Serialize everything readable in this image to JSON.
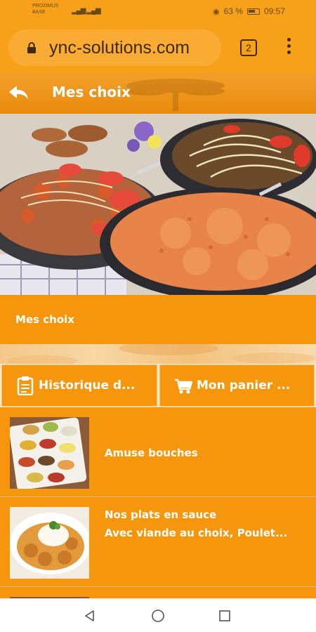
{
  "status_bar": {
    "carrier_line1": "PROXIMUS",
    "carrier_line2": "BASE",
    "signal": "▂▄▆ ▂▄▆",
    "battery_percent": "63 %",
    "time": "09:57"
  },
  "browser": {
    "url": "ync-solutions.com",
    "tab_count": "2"
  },
  "header": {
    "title": "Mes choix"
  },
  "section": {
    "title": "Mes choix"
  },
  "actions": {
    "history_label": "Historique d...",
    "cart_label": "Mon panier ..."
  },
  "menu_items": [
    {
      "title": "Amuse bouches",
      "subtitle": ""
    },
    {
      "title": "Nos plats en sauce",
      "subtitle": "Avec viande au choix, Poulet..."
    }
  ],
  "colors": {
    "primary": "#f5960c",
    "browser_bar": "#f7a01a",
    "text": "#ffffff"
  }
}
